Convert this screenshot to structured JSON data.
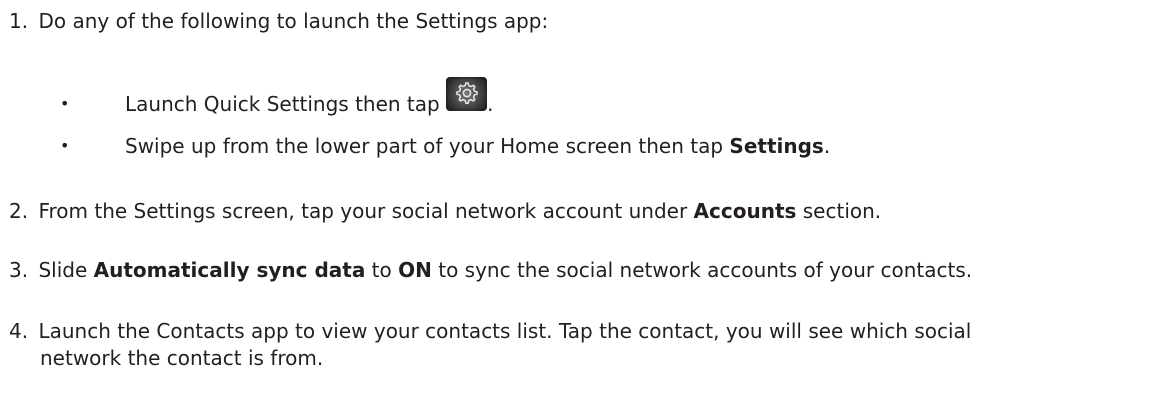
{
  "steps": [
    {
      "number": "1.",
      "text": "Do any of the following to launch the Settings app:",
      "bullets": [
        {
          "before": "Launch Quick Settings then tap",
          "icon": "settings-gear-icon",
          "after": "."
        },
        {
          "before": "Swipe up from the lower part of your Home screen then tap ",
          "bold": "Settings",
          "after": "."
        }
      ]
    },
    {
      "number": "2.",
      "before": "From the Settings screen, tap your social network account under ",
      "bold": "Accounts",
      "after": " section."
    },
    {
      "number": "3.",
      "before": "Slide ",
      "bold1": "Automatically sync data",
      "mid": " to ",
      "bold2": "ON",
      "after": " to sync the social network accounts of your contacts."
    },
    {
      "number": "4.",
      "line1": "Launch the Contacts app to view your contacts list. Tap the contact, you will see which social",
      "line2": "network the contact is from."
    }
  ],
  "bullet_glyph": "•"
}
